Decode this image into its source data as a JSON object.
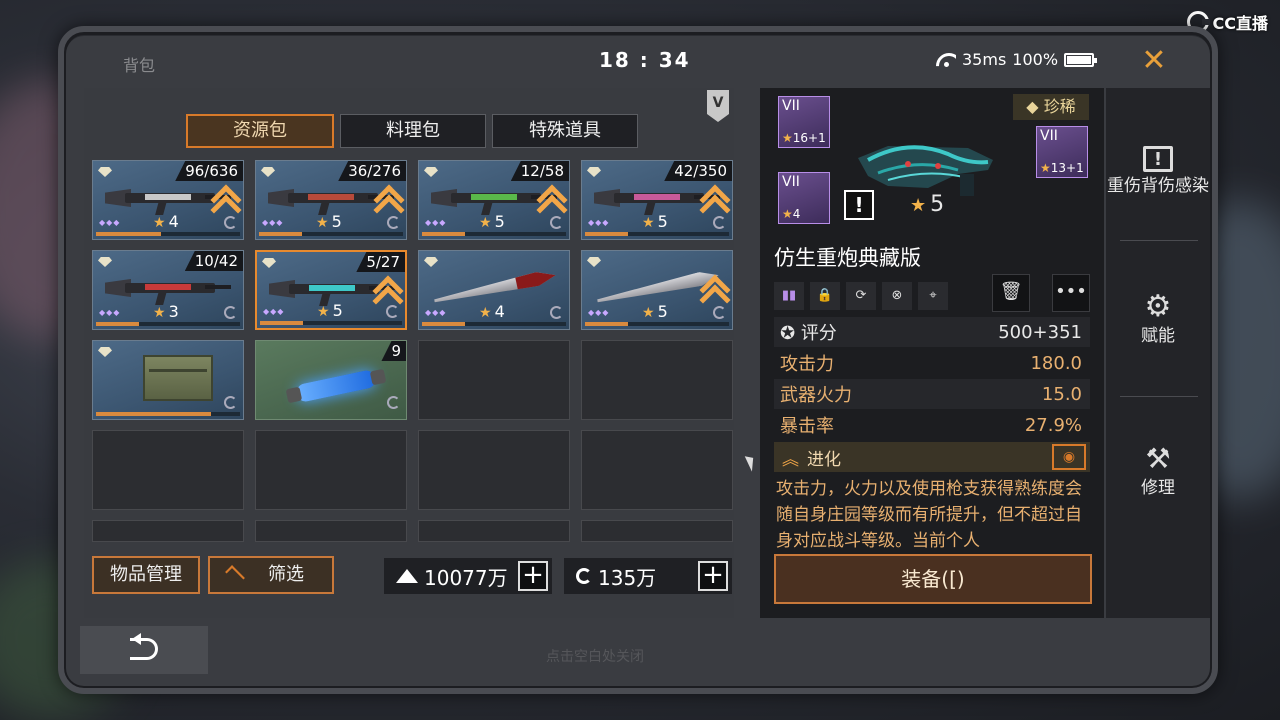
{
  "watermark": "CC直播",
  "app_title": "背包",
  "status": {
    "time": "18 : 34",
    "ping": "35ms",
    "battery": "100%"
  },
  "tabs": [
    "资源包",
    "料理包",
    "特殊道具"
  ],
  "v_badge": "V",
  "items": [
    {
      "count": "96/636",
      "stars": "4",
      "type": "gun",
      "upgrade": true,
      "progress": 0.45
    },
    {
      "count": "36/276",
      "stars": "5",
      "type": "gun",
      "upgrade": true,
      "progress": 0.3
    },
    {
      "count": "12/58",
      "stars": "5",
      "type": "gun",
      "upgrade": true,
      "progress": 0.3
    },
    {
      "count": "42/350",
      "stars": "5",
      "type": "gun",
      "upgrade": true,
      "progress": 0.3
    },
    {
      "count": "10/42",
      "stars": "3",
      "type": "gun",
      "upgrade": false,
      "progress": 0.3
    },
    {
      "count": "5/27",
      "stars": "5",
      "type": "gun",
      "upgrade": true,
      "progress": 0.3,
      "selected": true
    },
    {
      "count": "",
      "stars": "4",
      "type": "blade",
      "upgrade": false,
      "progress": 0.3
    },
    {
      "count": "",
      "stars": "5",
      "type": "blade",
      "upgrade": true,
      "progress": 0.3
    },
    {
      "count": "",
      "stars": "",
      "type": "crate",
      "upgrade": false,
      "progress": 0.8
    },
    {
      "count": "9",
      "stars": "",
      "type": "vial",
      "upgrade": false,
      "progress": 0
    }
  ],
  "buttons": {
    "manage": "物品管理",
    "filter": "筛选",
    "equip": "装备([)",
    "close": "✕"
  },
  "currency": [
    {
      "value": "10077万"
    },
    {
      "value": "135万"
    }
  ],
  "hint": "点击空白处关闭",
  "detail": {
    "rarity": "珍稀",
    "mods": [
      {
        "level": "VII",
        "value": "16+1"
      },
      {
        "level": "VII",
        "value": "13+1"
      },
      {
        "level": "VII",
        "value": "4"
      }
    ],
    "stars": "5",
    "warning": "!",
    "name": "仿生重炮典藏版",
    "stats": [
      {
        "label": "评分",
        "value": "500+351"
      },
      {
        "label": "攻击力",
        "value": "180.0"
      },
      {
        "label": "武器火力",
        "value": "15.0"
      },
      {
        "label": "暴击率",
        "value": "27.9%"
      }
    ],
    "evolve_label": "进化",
    "description": "攻击力，火力以及使用枪支获得熟练度会随自身庄园等级而有所提升，但不超过自身对应战斗等级。当前个人"
  },
  "side_menu": [
    "重伤背伤感染",
    "赋能",
    "修理"
  ],
  "colors": {
    "accent": "#d87a2a",
    "rare_purple": "#6a4f8e",
    "stat_text": "#e8b070"
  }
}
